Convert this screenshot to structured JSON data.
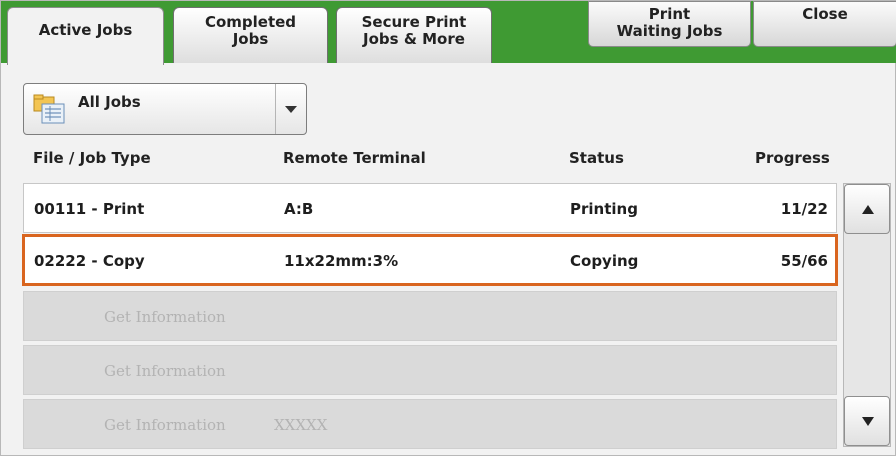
{
  "tabs": [
    {
      "label": "Active Jobs",
      "active": true
    },
    {
      "label": "Completed\nJobs",
      "active": false
    },
    {
      "label": "Secure Print\nJobs & More",
      "active": false
    }
  ],
  "actions": {
    "print_waiting": "Print\nWaiting Jobs",
    "close": "Close"
  },
  "filter": {
    "value": "All Jobs",
    "icon": "folder-list-icon"
  },
  "columns": {
    "file_job_type": "File / Job Type",
    "remote_terminal": "Remote Terminal",
    "status": "Status",
    "progress": "Progress"
  },
  "rows": [
    {
      "file_job_type": "00111 - Print",
      "remote_terminal": "A:B",
      "status": "Printing",
      "progress": "11/22"
    },
    {
      "file_job_type": "02222 - Copy",
      "remote_terminal": "11x22mm:3%",
      "status": "Copying",
      "progress": "55/66",
      "selected": true
    },
    {
      "file_job_type": "Get Information",
      "remote_terminal": "",
      "status": "",
      "progress": ""
    },
    {
      "file_job_type": "Get Information",
      "remote_terminal": "",
      "status": "",
      "progress": ""
    },
    {
      "file_job_type": "Get Information",
      "remote_terminal": "XXXXX",
      "status": "",
      "progress": ""
    }
  ],
  "colors": {
    "tabbar_green": "#3f9a33",
    "selection_orange": "#d9651f"
  }
}
